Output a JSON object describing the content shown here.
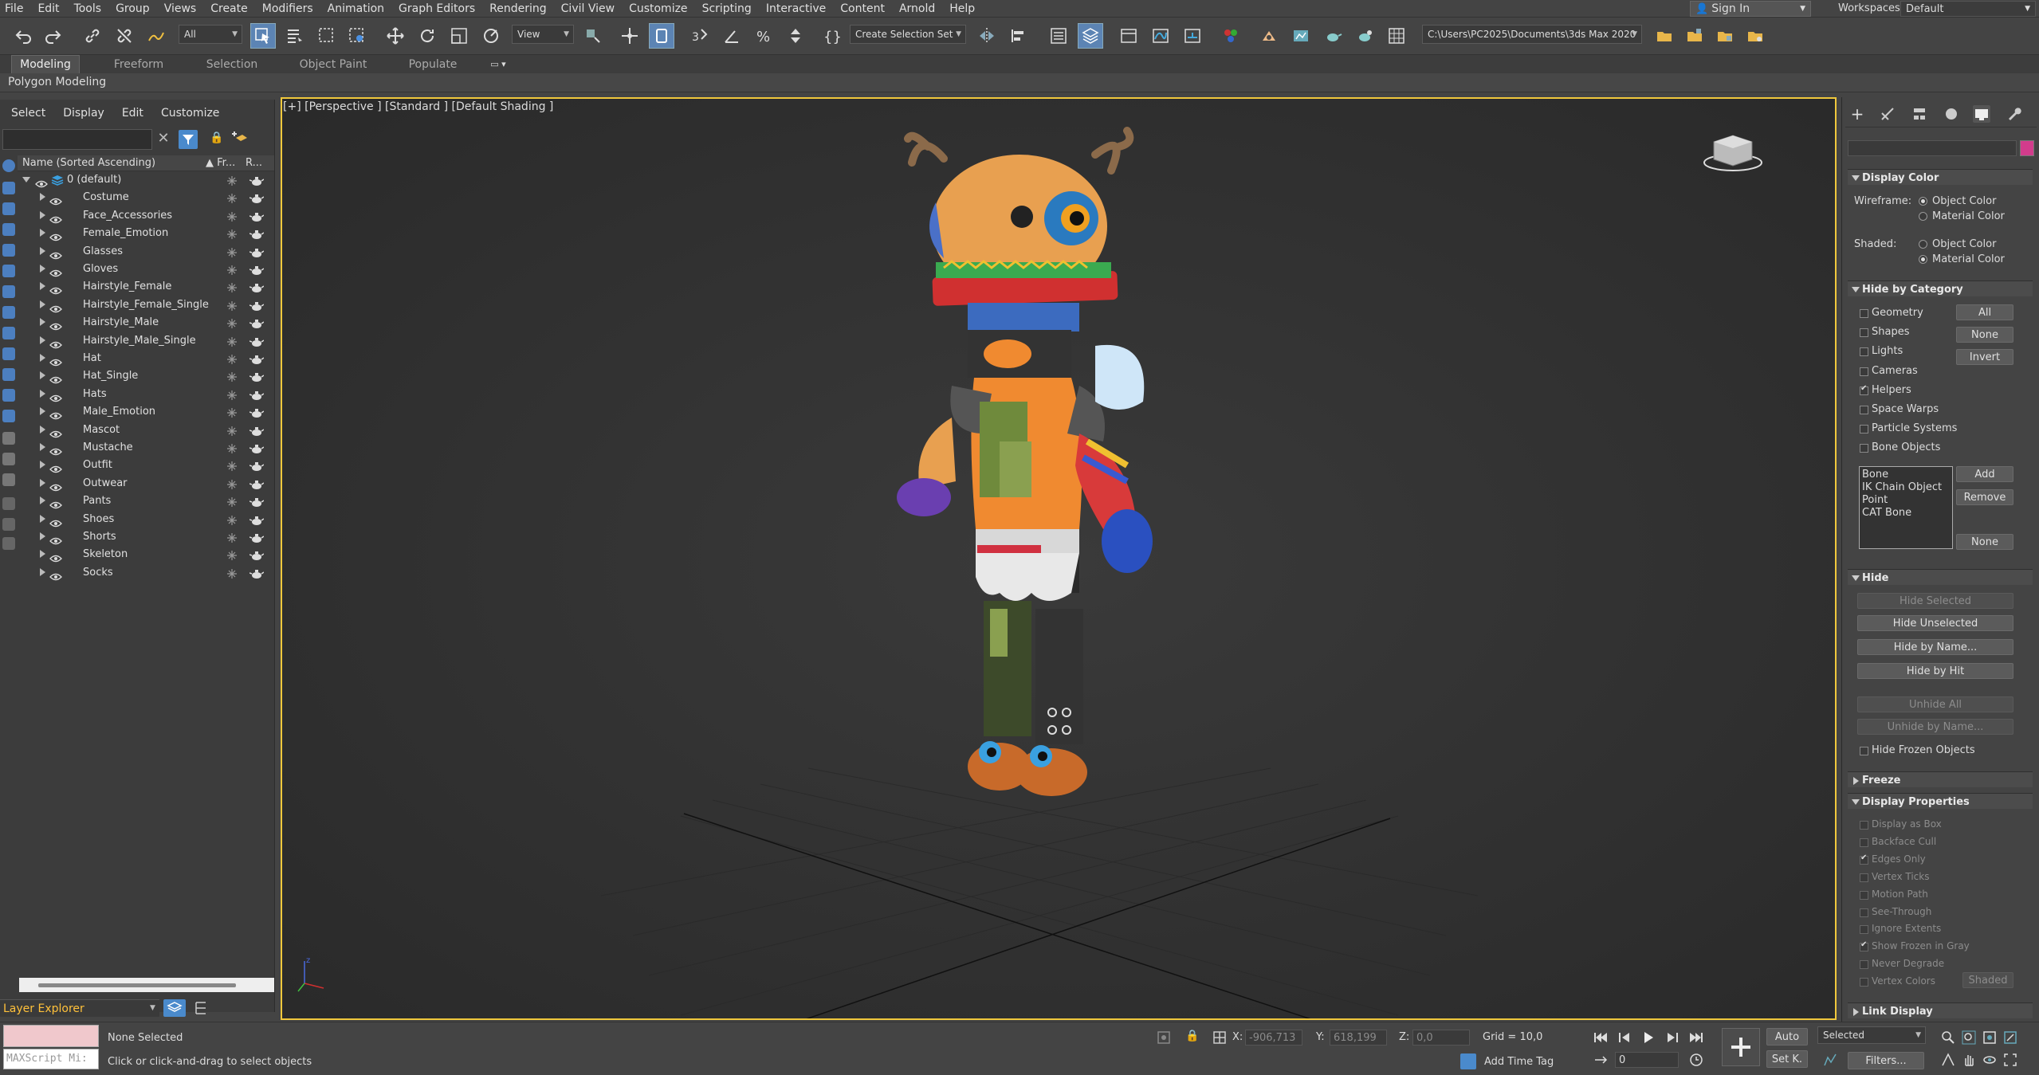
{
  "menu": [
    "File",
    "Edit",
    "Tools",
    "Group",
    "Views",
    "Create",
    "Modifiers",
    "Animation",
    "Graph Editors",
    "Rendering",
    "Civil View",
    "Customize",
    "Scripting",
    "Interactive",
    "Content",
    "Arnold",
    "Help"
  ],
  "account": {
    "sign_in": "Sign In",
    "workspaces_label": "Workspaces:",
    "workspace": "Default"
  },
  "toolbar": {
    "selection_filter": "All",
    "ref_coord": "View",
    "named_selection": "Create Selection Set",
    "project_path": "C:\\Users\\PC2025\\Documents\\3ds Max 2020"
  },
  "ribbon": {
    "tabs": [
      "Modeling",
      "Freeform",
      "Selection",
      "Object Paint",
      "Populate"
    ],
    "active_tab": "Modeling",
    "panel": "Polygon Modeling"
  },
  "explorer": {
    "menu": [
      "Select",
      "Display",
      "Edit",
      "Customize"
    ],
    "header_name": "Name (Sorted Ascending)",
    "header_frozen": "▲ Fr...",
    "header_render": "R...",
    "root_layer": "0 (default)",
    "layers": [
      "Costume",
      "Face_Accessories",
      "Female_Emotion",
      "Glasses",
      "Gloves",
      "Hairstyle_Female",
      "Hairstyle_Female_Single",
      "Hairstyle_Male",
      "Hairstyle_Male_Single",
      "Hat",
      "Hat_Single",
      "Hats",
      "Male_Emotion",
      "Mascot",
      "Mustache",
      "Outfit",
      "Outwear",
      "Pants",
      "Shoes",
      "Shorts",
      "Skeleton",
      "Socks"
    ],
    "footer_label": "Layer Explorer"
  },
  "viewport": {
    "label": "[+] [Perspective ] [Standard ] [Default Shading ]"
  },
  "display_color": {
    "title": "Display Color",
    "wireframe_label": "Wireframe:",
    "shaded_label": "Shaded:",
    "object_color": "Object Color",
    "material_color": "Material Color",
    "wireframe_value": "Object Color",
    "shaded_value": "Material Color",
    "swatch_color": "#d23c8c"
  },
  "hide_by_category": {
    "title": "Hide by Category",
    "items": [
      {
        "label": "Geometry",
        "checked": false
      },
      {
        "label": "Shapes",
        "checked": false
      },
      {
        "label": "Lights",
        "checked": false
      },
      {
        "label": "Cameras",
        "checked": false
      },
      {
        "label": "Helpers",
        "checked": true
      },
      {
        "label": "Space Warps",
        "checked": false
      },
      {
        "label": "Particle Systems",
        "checked": false
      },
      {
        "label": "Bone Objects",
        "checked": false
      }
    ],
    "btn_all": "All",
    "btn_none": "None",
    "btn_invert": "Invert",
    "list": [
      "Bone",
      "IK Chain Object",
      "Point",
      "CAT Bone"
    ],
    "btn_add": "Add",
    "btn_remove": "Remove",
    "btn_none2": "None"
  },
  "hide": {
    "title": "Hide",
    "hide_selected": "Hide Selected",
    "hide_unselected": "Hide Unselected",
    "hide_by_name": "Hide by Name...",
    "hide_by_hit": "Hide by Hit",
    "unhide_all": "Unhide All",
    "unhide_by_name": "Unhide by Name...",
    "hide_frozen": "Hide Frozen Objects"
  },
  "freeze": {
    "title": "Freeze"
  },
  "display_properties": {
    "title": "Display Properties",
    "items": [
      {
        "label": "Display as Box",
        "checked": false
      },
      {
        "label": "Backface Cull",
        "checked": false
      },
      {
        "label": "Edges Only",
        "checked": true
      },
      {
        "label": "Vertex Ticks",
        "checked": false
      },
      {
        "label": "Motion Path",
        "checked": false
      },
      {
        "label": "See-Through",
        "checked": false
      },
      {
        "label": "Ignore Extents",
        "checked": false
      },
      {
        "label": "Show Frozen in Gray",
        "checked": true
      },
      {
        "label": "Never Degrade",
        "checked": false
      },
      {
        "label": "Vertex Colors",
        "checked": false
      }
    ],
    "shaded_btn": "Shaded"
  },
  "link_display": {
    "title": "Link Display"
  },
  "status": {
    "maxscript": "MAXScript Mi:",
    "selection": "None Selected",
    "prompt": "Click or click-and-drag to select objects",
    "x_label": "X:",
    "x_value": "-906,713",
    "y_label": "Y:",
    "y_value": "618,199",
    "z_label": "Z:",
    "z_value": "0,0",
    "grid": "Grid = 10,0",
    "add_time_tag": "Add Time Tag",
    "auto": "Auto",
    "set_key": "Set K.",
    "key_filter": "Selected",
    "filters": "Filters...",
    "frame": "0"
  }
}
